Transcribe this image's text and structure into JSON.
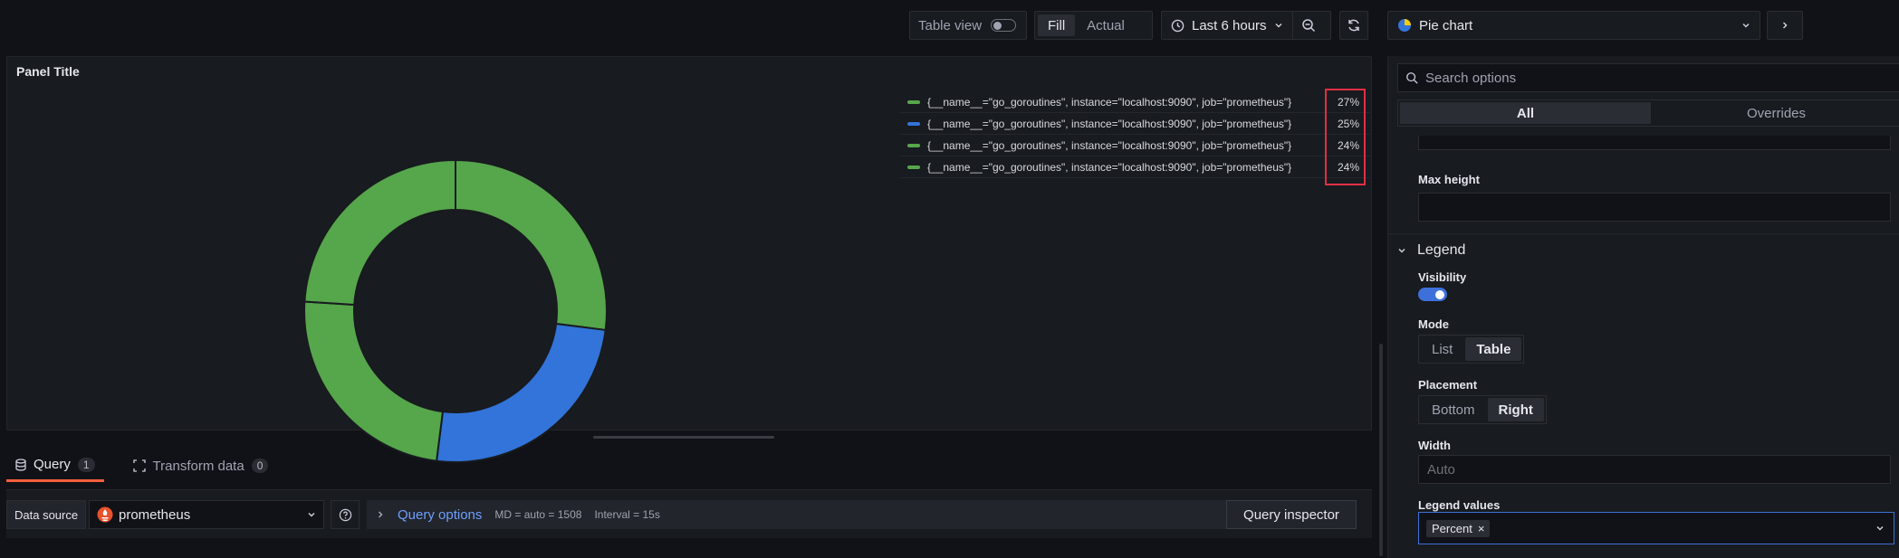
{
  "toolbar": {
    "table_view_label": "Table view",
    "fill_label": "Fill",
    "actual_label": "Actual",
    "time_range": "Last 6 hours",
    "visualization": "Pie chart"
  },
  "panel": {
    "title": "Panel Title"
  },
  "chart_data": {
    "type": "pie",
    "donut": true,
    "legend_placement": "right",
    "series": [
      {
        "name": "{__name__=\"go_goroutines\", instance=\"localhost:9090\", job=\"prometheus\"}",
        "value": 27,
        "label": "27%",
        "color": "#56a64b"
      },
      {
        "name": "{__name__=\"go_goroutines\", instance=\"localhost:9090\", job=\"prometheus\"}",
        "value": 25,
        "label": "25%",
        "color": "#3274d9"
      },
      {
        "name": "{__name__=\"go_goroutines\", instance=\"localhost:9090\", job=\"prometheus\"}",
        "value": 24,
        "label": "24%",
        "color": "#56a64b"
      },
      {
        "name": "{__name__=\"go_goroutines\", instance=\"localhost:9090\", job=\"prometheus\"}",
        "value": 24,
        "label": "24%",
        "color": "#56a64b"
      }
    ]
  },
  "query": {
    "tabs": [
      {
        "label": "Query",
        "count": "1"
      },
      {
        "label": "Transform data",
        "count": "0"
      }
    ],
    "data_source_label": "Data source",
    "data_source": "prometheus",
    "options_link": "Query options",
    "md": "MD = auto = 1508",
    "interval": "Interval = 15s",
    "inspector": "Query inspector"
  },
  "options": {
    "search_placeholder": "Search options",
    "tabs": [
      "All",
      "Overrides"
    ],
    "max_height_label": "Max height",
    "legend_section": "Legend",
    "visibility_label": "Visibility",
    "mode_label": "Mode",
    "mode_options": [
      "List",
      "Table"
    ],
    "placement_label": "Placement",
    "placement_options": [
      "Bottom",
      "Right"
    ],
    "width_label": "Width",
    "width_placeholder": "Auto",
    "legend_values_label": "Legend values",
    "legend_values_tag": "Percent"
  },
  "colors": {
    "green": "#56a64b",
    "blue": "#3274d9",
    "accent_orange": "#f55f3e",
    "highlight_red": "#e02f44"
  }
}
